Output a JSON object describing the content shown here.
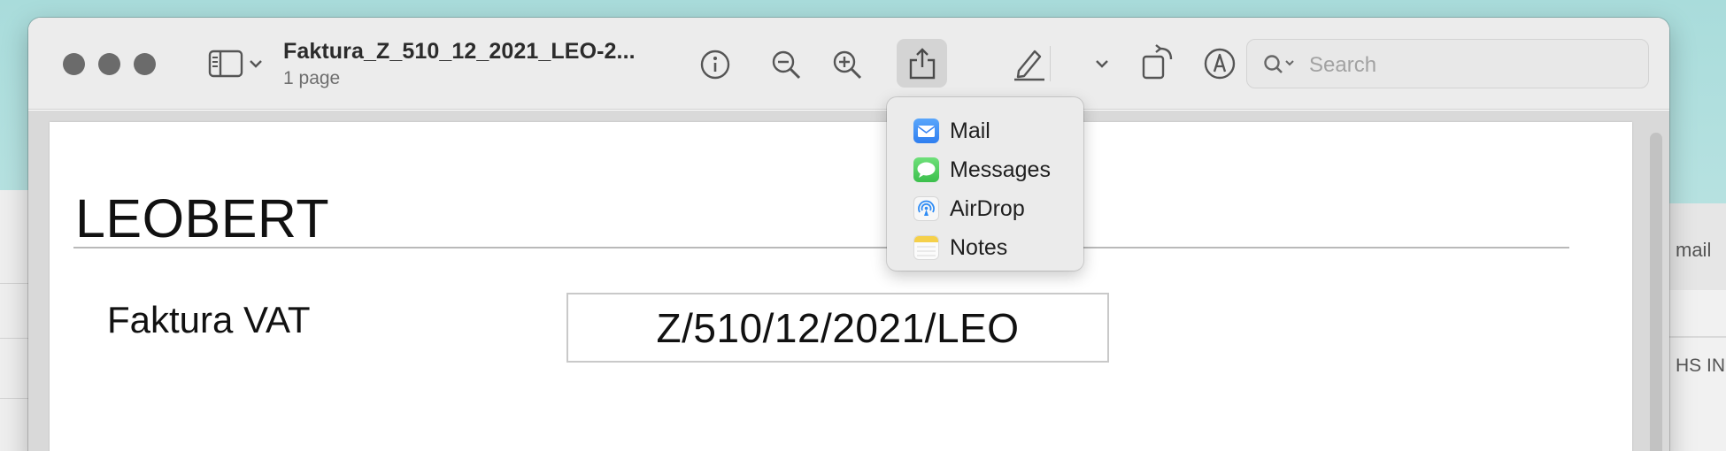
{
  "window": {
    "title": "Faktura_Z_510_12_2021_LEO-2...",
    "subtitle": "1 page"
  },
  "toolbar": {
    "icons": [
      "sidebar-icon",
      "chevron-down-icon",
      "info-icon",
      "zoom-out-icon",
      "zoom-in-icon",
      "share-icon",
      "highlight-pen-icon",
      "chevron-down-icon",
      "rotate-icon",
      "markup-icon",
      "search-icon"
    ],
    "search_placeholder": "Search"
  },
  "share_menu": {
    "items": [
      {
        "label": "Mail",
        "icon": "mail-icon",
        "color": "#3d8af7"
      },
      {
        "label": "Messages",
        "icon": "messages-icon",
        "color": "#4fc759"
      },
      {
        "label": "AirDrop",
        "icon": "airdrop-icon",
        "color": "#2f8cf5"
      },
      {
        "label": "Notes",
        "icon": "notes-icon",
        "color": "#f5d04a"
      }
    ]
  },
  "document": {
    "company": "LEOBERT",
    "doc_type": "Faktura VAT",
    "invoice_number": "Z/510/12/2021/LEO"
  },
  "background_window": {
    "texts": [
      "mail",
      "HS IN"
    ]
  }
}
